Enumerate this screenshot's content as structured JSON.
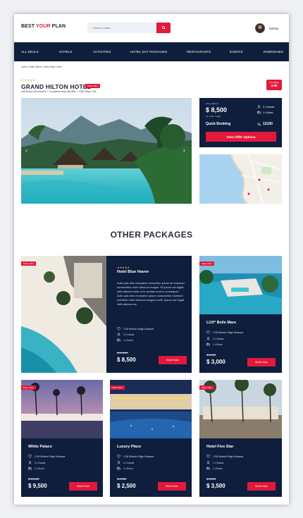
{
  "header": {
    "logo_main": "BEST ",
    "logo_accent": "YOUR",
    "logo_end": " PLAN",
    "search_placeholder": "Search Location",
    "user_name": "Nathan"
  },
  "nav": [
    "ALL DEALS",
    "HOTELS",
    "ACTIVITIES",
    "HOTEL DAY PACKAGES",
    "RESTAURANTS",
    "EVENTS",
    "RODRIGUES"
  ],
  "breadcrumb": "Home / Flash Offers / Grand Hilton Hotel",
  "hotel": {
    "stars": "★★★★★",
    "title": "GRAND HILTON HOTEL",
    "tag": "Flash Offer",
    "subtitle": "Half Board /All Inclusive + Complementary Activities + Child Stays Free",
    "rating_label": "Our Rating",
    "rating_value": "4.5k"
  },
  "booking": {
    "price_from": "price starts at",
    "price": "$ 8,500",
    "per": "per room / night",
    "guests": "2 x Guests",
    "rooms": "1 x Room",
    "quick": "Quick Booking",
    "phone": "12100",
    "button": "View Offer Options"
  },
  "section_title": "OTHER PACKAGES",
  "packages": [
    {
      "badge": "Flash Offer",
      "stars": "★★★★★",
      "name": "Hotel Blue Haven",
      "desc": "Aute quis duis excepteur excepteur ipsum sit eiusmod consectetur enim laborum magna. Et ipsum est fugiat velit ullamco esse ut in veniam sunt in consequat. Aute quis duis excepteur ipsum consectetur eiusmod mextetur enim laborum magna mollit. Ipsum est fugiat velit ullamco ea",
      "address": "1748 Wheeler Ridge Delaware",
      "guests": "2 x Guests",
      "rooms": "1 x Room",
      "old": "$ 10,000",
      "price": "$ 8,500",
      "button": "Book Now"
    },
    {
      "badge": "Flash Offer",
      "name": "LUX* Belle Mare",
      "address": "1748 Wheeler Ridge Delaware",
      "guests": "2 x Guests",
      "rooms": "1 x Room",
      "old": "$ 5,000",
      "price": "$ 3,000",
      "button": "Book Now"
    },
    {
      "badge": "Flash Offer",
      "name": "White Palace",
      "address": "1748 Wheeler Ridge Delaware",
      "guests": "2 x Guests",
      "rooms": "1 x Room",
      "old": "$ 10,000",
      "price": "$ 9,500",
      "button": "Book Now"
    },
    {
      "badge": "Flash Offer",
      "name": "Luxury Place",
      "address": "1748 Wheeler Ridge Delaware",
      "guests": "2 x Guests",
      "rooms": "1 x Room",
      "old": "$ 4,000",
      "price": "$ 2,500",
      "button": "Book Now"
    },
    {
      "badge": "Flash Offer",
      "name": "Hotel Five Star",
      "address": "1748 Wheeler Ridge Delaware",
      "guests": "2 x Guests",
      "rooms": "1 x Room",
      "old": "$ 5,000",
      "price": "$ 3,500",
      "button": "Book Now"
    }
  ],
  "icons": {
    "search": "search-icon",
    "location": "location-icon",
    "user": "user-icon",
    "bed": "bed-icon",
    "phone": "phone-icon"
  },
  "colors": {
    "accent": "#e3193b",
    "navy": "#0f1e3d",
    "star": "#f3a83b"
  }
}
